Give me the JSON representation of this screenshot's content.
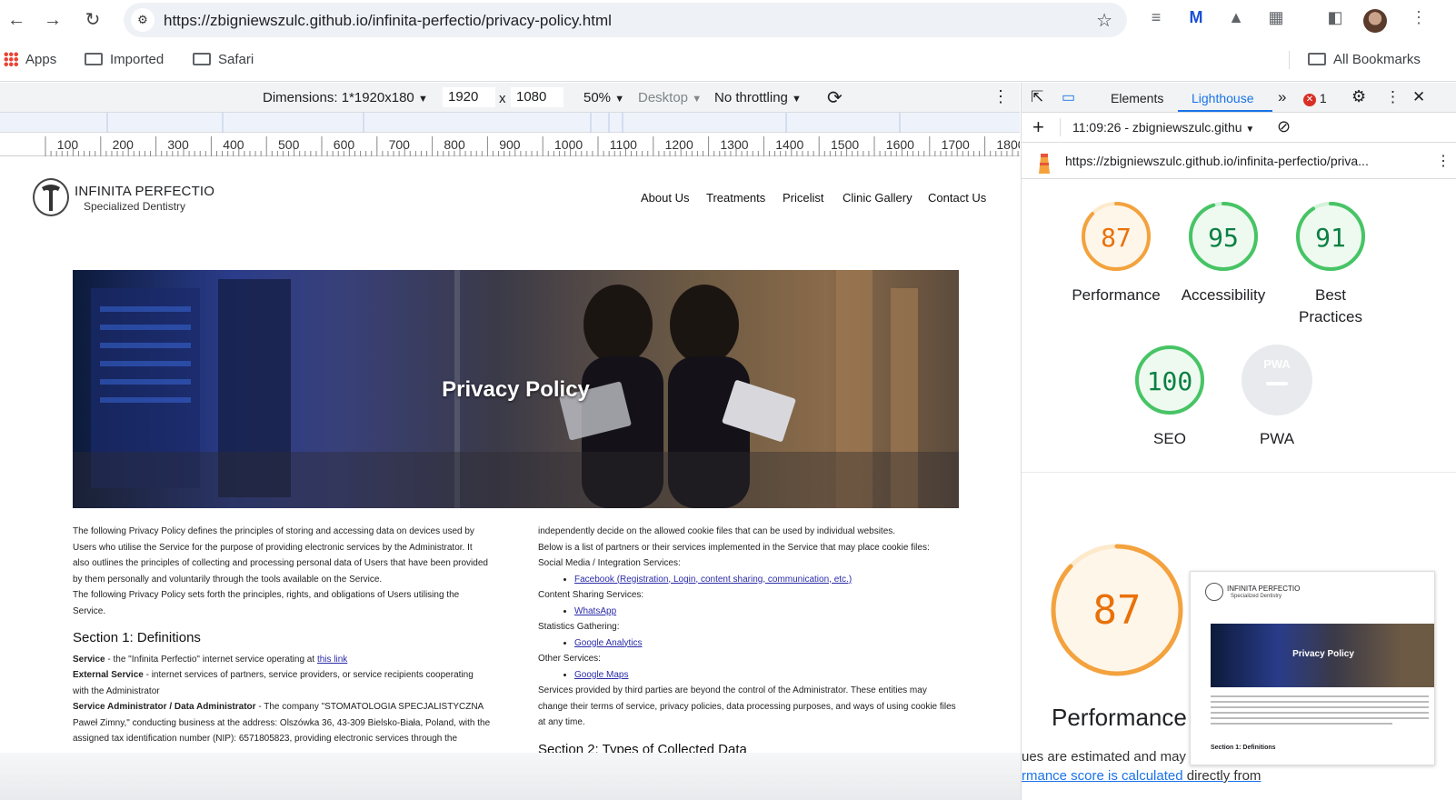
{
  "browser": {
    "url": "https://zbigniewszulc.github.io/infinita-perfectio/privacy-policy.html"
  },
  "bookmarks": {
    "items": [
      "Apps",
      "Imported",
      "Safari"
    ],
    "all_bookmarks": "All Bookmarks"
  },
  "device_toolbar": {
    "dimensions": "Dimensions: 1*1920x180",
    "width": "1920",
    "times": "x",
    "height": "1080",
    "zoom": "50%",
    "device_type": "Desktop",
    "throttling": "No throttling"
  },
  "ruler": {
    "ticks": [
      "100",
      "200",
      "300",
      "400",
      "500",
      "600",
      "700",
      "800",
      "900",
      "1000",
      "1100",
      "1200",
      "1300",
      "1400",
      "1500",
      "1600",
      "1700",
      "1800"
    ]
  },
  "site": {
    "logo_name": "INFINITA PERFECTIO",
    "logo_sub": "Specialized Dentistry",
    "nav": [
      "About Us",
      "Treatments",
      "Pricelist",
      "Clinic Gallery",
      "Contact Us"
    ],
    "hero_title": "Privacy Policy",
    "left": {
      "intro1": "The following Privacy Policy defines the principles of storing and accessing data on devices used by Users who utilise the Service for the purpose of providing electronic services by the Administrator. It also outlines the principles of collecting and processing personal data of Users that have been provided by them personally and voluntarily through the tools available on the Service.",
      "intro2": "The following Privacy Policy sets forth the principles, rights, and obligations of Users utilising the Service.",
      "section1": "Section 1: Definitions",
      "def1_term": "Service",
      "def1_text": " - the \"Infinita Perfectio\" internet service operating at ",
      "def1_link": "this link",
      "def2_term": "External Service",
      "def2_text": " - internet services of partners, service providers, or service recipients cooperating with the Administrator",
      "def3_term": "Service Administrator / Data Administrator",
      "def3_text": " - The company \"STOMATOLOGIA SPECJALISTYCZNA Paweł Zimny,\" conducting business at the address: Olszówka 36, 43-309 Bielsko-Biała, Poland, with the assigned tax identification number (NIP): 6571805823, providing electronic services through the"
    },
    "right": {
      "p1": "independently decide on the allowed cookie files that can be used by individual websites.",
      "p2": "Below is a list of partners or their services implemented in the Service that may place cookie files:",
      "g1": "Social Media / Integration Services:",
      "g1_link": "Facebook (Registration, Login, content sharing, communication, etc.)",
      "g2": "Content Sharing Services:",
      "g2_link": "WhatsApp",
      "g3": "Statistics Gathering:",
      "g3_link": "Google Analytics",
      "g4": "Other Services:",
      "g4_link": "Google Maps",
      "p3": "Services provided by third parties are beyond the control of the Administrator. These entities may change their terms of service, privacy policies, data processing purposes, and ways of using cookie files at any time.",
      "section2": "Section 2: Types of Collected Data"
    }
  },
  "devtools": {
    "tabs": [
      "Elements",
      "Lighthouse"
    ],
    "more": "»",
    "error_count": "1",
    "report_time": "11:09:26 - zbigniewszulc.githu",
    "audited_url": "https://zbigniewszulc.github.io/infinita-perfectio/priva...",
    "scores": [
      {
        "label": "Performance",
        "value": 87,
        "color": "#e8710a",
        "ring": "#f3a23e"
      },
      {
        "label": "Accessibility",
        "value": 95,
        "color": "#0b8043",
        "ring": "#47c465"
      },
      {
        "label": "Best Practices",
        "value": 91,
        "color": "#0b8043",
        "ring": "#47c465"
      },
      {
        "label": "SEO",
        "value": 100,
        "color": "#0b8043",
        "ring": "#47c465"
      },
      {
        "label": "PWA",
        "value": null,
        "badge": "PWA",
        "color": "#9aa0a6",
        "ring": "#dadce0"
      }
    ],
    "perf_big": {
      "value": "87",
      "label": "Performance"
    },
    "est_text": "ues are estimated and may vary.",
    "est_link": "rmance score is calculated",
    "est_link_after": " directly from",
    "thumb": {
      "logo_name": "INFINITA PERFECTIO",
      "logo_sub": "Specialized Dentistry",
      "hero": "Privacy Policy",
      "section": "Section 1: Definitions"
    }
  }
}
